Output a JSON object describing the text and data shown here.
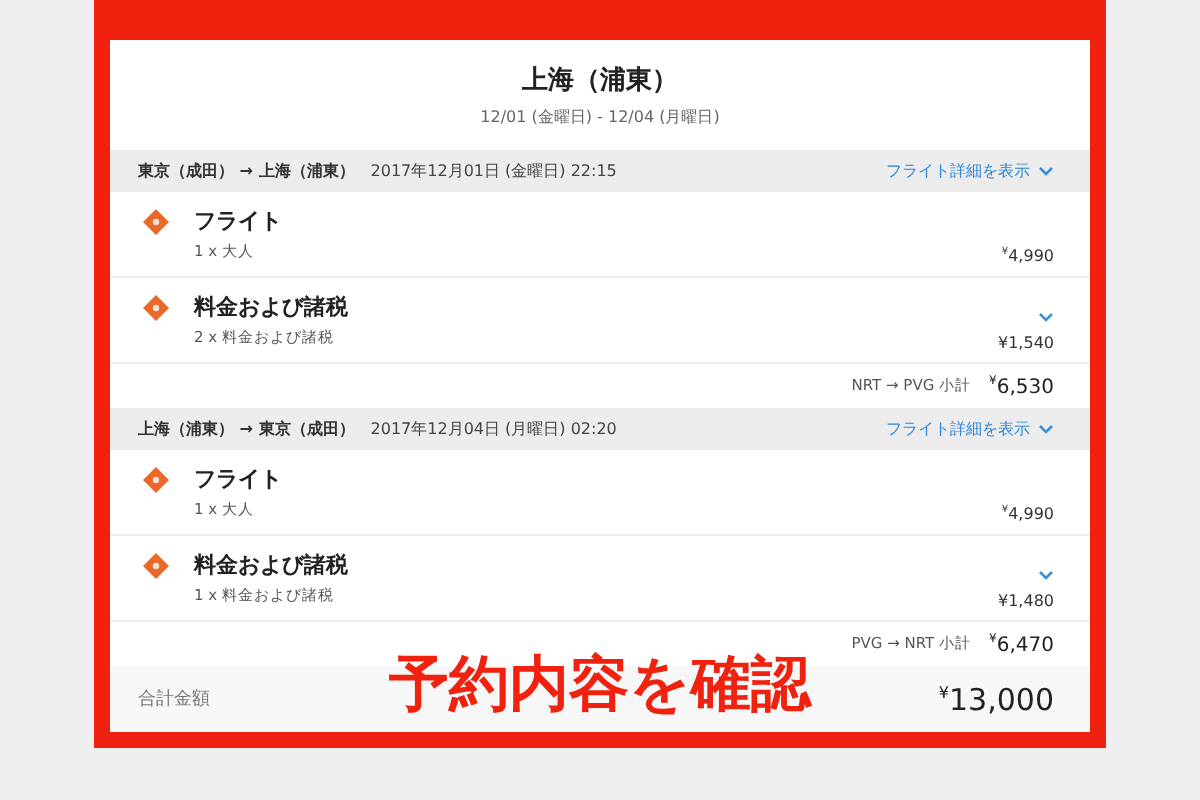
{
  "header": {
    "title": "上海（浦東）",
    "dates": "12/01 (金曜日) - 12/04 (月曜日)"
  },
  "segments": [
    {
      "route": "東京（成田） → 上海（浦東）",
      "datetime": "2017年12月01日 (金曜日) 22:15",
      "details_link": "フライト詳細を表示",
      "items": [
        {
          "kind": "flight",
          "name": "フライト",
          "detail": "1 x 大人",
          "price": "$^{¥}$4,990"
        },
        {
          "kind": "tax",
          "name": "料金および諸税",
          "detail": "2 x 料金および諸税",
          "price": "¥1,540"
        }
      ],
      "subtotal_label": "NRT → PVG 小計",
      "subtotal": "$^{¥}$6,530"
    },
    {
      "route": "上海（浦東） → 東京（成田）",
      "datetime": "2017年12月04日 (月曜日) 02:20",
      "details_link": "フライト詳細を表示",
      "items": [
        {
          "kind": "flight",
          "name": "フライト",
          "detail": "1 x 大人",
          "price": "$^{¥}$4,990"
        },
        {
          "kind": "tax",
          "name": "料金および諸税",
          "detail": "1 x 料金および諸税",
          "price": "¥1,480"
        }
      ],
      "subtotal_label": "PVG → NRT 小計",
      "subtotal": "$^{¥}$6,470"
    }
  ],
  "total": {
    "label": "合計金額",
    "amount": "$^{¥}$13,000"
  },
  "caption": "予約内容を確認"
}
